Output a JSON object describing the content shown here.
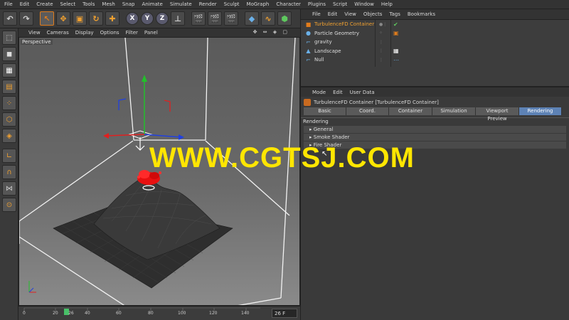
{
  "menubar": [
    "File",
    "Edit",
    "Create",
    "Select",
    "Tools",
    "Mesh",
    "Snap",
    "Animate",
    "Simulate",
    "Render",
    "Sculpt",
    "MoGraph",
    "Character",
    "Plugins",
    "Script",
    "Window",
    "Help"
  ],
  "toolbar": {
    "x": "X",
    "y": "Y",
    "z": "Z"
  },
  "viewport": {
    "menu": [
      "View",
      "Cameras",
      "Display",
      "Options",
      "Filter",
      "Panel"
    ],
    "label": "Perspective",
    "icons": "✥ ⇔ ◈ ▢"
  },
  "timeline": {
    "ticks": [
      "0",
      "20",
      "26",
      "40",
      "60",
      "80",
      "100",
      "120",
      "140"
    ],
    "current_frame": "26 F"
  },
  "objects": {
    "menu": [
      "File",
      "Edit",
      "View",
      "Objects",
      "Tags",
      "Bookmarks"
    ],
    "items": [
      {
        "name": "TurbulenceFD Container",
        "selected": true
      },
      {
        "name": "Particle Geometry",
        "selected": false
      },
      {
        "name": "gravity",
        "selected": false
      },
      {
        "name": "Landscape",
        "selected": false
      },
      {
        "name": "Null",
        "selected": false
      }
    ]
  },
  "attributes": {
    "menu": [
      "Mode",
      "Edit",
      "User Data"
    ],
    "title": "TurbulenceFD Container [TurbulenceFD Container]",
    "tabs": [
      "Basic",
      "Coord.",
      "Container",
      "Simulation",
      "Viewport Preview",
      "Rendering"
    ],
    "section": "Rendering",
    "groups": [
      "General",
      "Smoke Shader",
      "Fire Shader"
    ]
  },
  "watermark": "WWW.CGTSJ.COM",
  "colors": {
    "accent": "#e07c1c",
    "tab_active": "#5d82b5",
    "watermark": "#ffe600",
    "fire": "#e81010"
  }
}
